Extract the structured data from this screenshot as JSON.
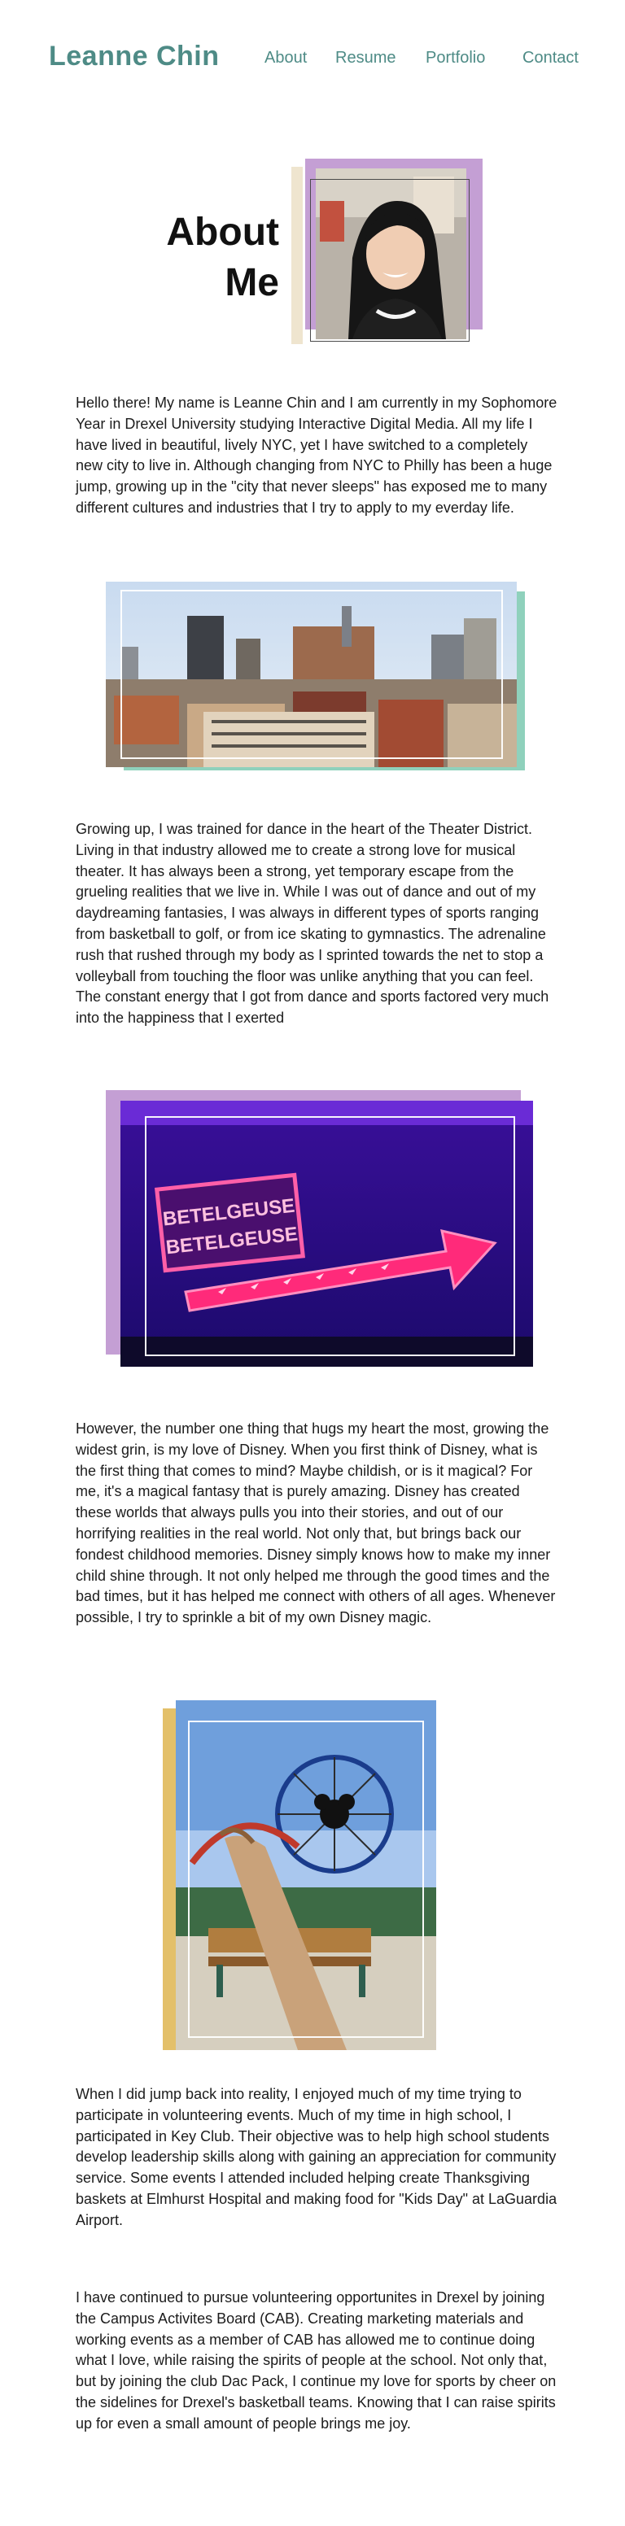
{
  "header": {
    "brand": "Leanne Chin",
    "nav": [
      "About",
      "Resume",
      "Portfolio",
      "Contact"
    ]
  },
  "about": {
    "title_line1": "About",
    "title_line2": "Me"
  },
  "paragraphs": {
    "p1": "Hello there! My name is Leanne Chin and I am currently in my Sophomore Year in Drexel University studying Interactive Digital Media. All my life I have lived in beautiful, lively NYC, yet I have switched to a completely new city to live in. Although changing from NYC to Philly has been a huge jump, growing up in the \"city that never sleeps\" has exposed me to many different cultures and industries that I try to apply to my everday life.",
    "p2": "Growing up, I was trained for dance in the heart of the Theater District. Living in that industry allowed me to create a strong love for musical theater. It has always been a strong, yet temporary escape from the grueling realities that we live in. While I was out of dance and out of my daydreaming fantasies, I was always in different types of sports ranging from basketball to golf, or from ice skating to gymnastics. The adrenaline rush that rushed through my body as I sprinted towards the net to stop a volleyball from touching the floor was unlike anything that you can feel. The constant energy that I got from dance and sports factored very much into the happiness that I exerted",
    "p3": "However, the number one thing that hugs my heart the most, growing the widest grin, is my love of Disney. When you first think of Disney, what is the first thing that comes to mind? Maybe childish, or is it magical? For me, it's a magical fantasy that is purely amazing. Disney has created these worlds that always pulls you into their stories, and out of our horrifying realities in the real world. Not only that, but brings back our fondest childhood memories. Disney simply knows how to make my inner child shine through. It not only helped me through the good times and the bad times, but it has helped me connect with others of all ages. Whenever possible, I try to sprinkle a bit of my own Disney magic.",
    "p4": "When I did jump back into reality, I enjoyed much of my time trying to participate in volunteering events. Much of my time in high school, I participated in Key Club. Their objective was to help high school students develop leadership skills along with gaining an appreciation for community service. Some events I attended included helping create Thanksgiving baskets at Elmhurst Hospital and making food for \"Kids Day\" at LaGuardia Airport.",
    "p5": "I have continued to pursue volunteering opportunites in Drexel by joining the Campus Activites Board (CAB). Creating marketing materials and working events as a member of CAB has allowed me to continue doing what I love, while raising the spirits of people at the school. Not only that, but by joining the club Dac Pack, I continue my love for sports by cheer on the sidelines for Drexel's basketball teams. Knowing that I can raise spirits up for even a small amount of people brings me joy."
  },
  "images": {
    "sign_line1": "BETELGEUSE",
    "sign_line2": "BETELGEUSE"
  },
  "colors": {
    "brand": "#4e8b86",
    "lavender": "#c49fd4",
    "mint": "#8fd1bc",
    "gold": "#e3c06a"
  }
}
